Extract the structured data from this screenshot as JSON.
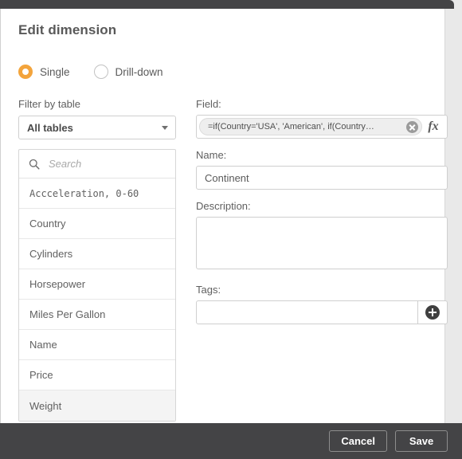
{
  "dialog": {
    "title": "Edit dimension",
    "mode_options": [
      {
        "label": "Single",
        "selected": true
      },
      {
        "label": "Drill-down",
        "selected": false
      }
    ]
  },
  "left_panel": {
    "filter_label": "Filter by table",
    "table_select": {
      "value": "All tables",
      "caret_icon": "chevron-down-icon"
    },
    "search": {
      "placeholder": "Search",
      "value": "",
      "icon": "search-icon"
    },
    "fields": [
      {
        "name": "Accceleration, 0-60",
        "mono": true,
        "hovered": false
      },
      {
        "name": "Country",
        "mono": false,
        "hovered": false
      },
      {
        "name": "Cylinders",
        "mono": false,
        "hovered": false
      },
      {
        "name": "Horsepower",
        "mono": false,
        "hovered": false
      },
      {
        "name": "Miles Per Gallon",
        "mono": false,
        "hovered": false
      },
      {
        "name": "Name",
        "mono": false,
        "hovered": false
      },
      {
        "name": "Price",
        "mono": false,
        "hovered": false
      },
      {
        "name": "Weight",
        "mono": false,
        "hovered": true
      }
    ]
  },
  "right_panel": {
    "field": {
      "label": "Field:",
      "token_text": "=if(Country='USA', 'American', if(Country…",
      "clear_icon": "close-circle-icon",
      "expression_editor_label": "fx"
    },
    "name": {
      "label": "Name:",
      "value": "Continent",
      "placeholder": ""
    },
    "description": {
      "label": "Description:",
      "value": "",
      "placeholder": ""
    },
    "tags": {
      "label": "Tags:",
      "value": "",
      "placeholder": "",
      "add_icon": "plus-circle-icon"
    }
  },
  "footer": {
    "cancel_label": "Cancel",
    "save_label": "Save"
  },
  "colors": {
    "accent": "#f3a43c",
    "chrome_dark": "#444446",
    "text": "#5a5a5a",
    "border": "#cfcfcf"
  }
}
